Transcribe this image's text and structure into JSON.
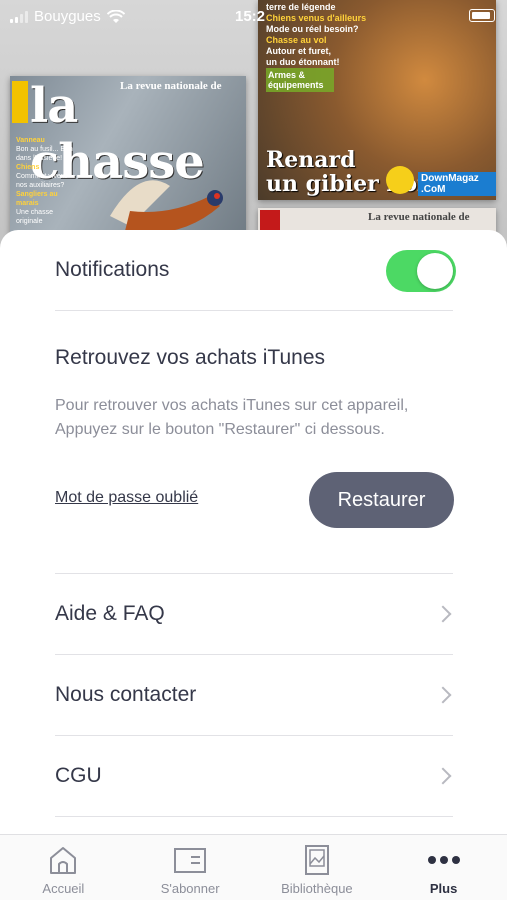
{
  "status_bar": {
    "carrier": "Bouygues",
    "time": "15:2"
  },
  "background_covers": {
    "left": {
      "masthead": "la chasse",
      "tagline": "La revue nationale de",
      "blurbs": [
        "Vanneau",
        "Bon au fusil... Bon dans l'assiette!",
        "Chiens",
        "Comment vivent nos auxiliaires?",
        "Sangliers au marais",
        "Une chasse originale"
      ]
    },
    "right": {
      "top_lines": [
        "terre de légende",
        "Chiens venus d'ailleurs",
        "Mode ou réel besoin?",
        "Chasse au vol",
        "Autour et furet,",
        "un duo étonnant!"
      ],
      "armes": "Armes & équipements",
      "headline_line1": "Renard",
      "headline_line2": "un gibier noi",
      "watermark": "DownMagaz .CoM"
    },
    "right2": {
      "tagline": "La revue nationale de"
    }
  },
  "settings": {
    "notifications_label": "Notifications",
    "notifications_on": true,
    "toggle_color": "#4cd964",
    "itunes_title": "Retrouvez vos achats iTunes",
    "itunes_description": "Pour retrouver vos achats iTunes sur cet appareil, Appuyez sur le bouton \"Restaurer\" ci dessous.",
    "forgot_password": "Mot de passe oublié",
    "restore_button": "Restaurer",
    "menu": [
      {
        "label": "Aide & FAQ",
        "icon": "chevron-right-icon"
      },
      {
        "label": "Nous contacter",
        "icon": "chevron-right-icon"
      },
      {
        "label": "CGU",
        "icon": "chevron-right-icon"
      }
    ]
  },
  "tabbar": {
    "tabs": [
      {
        "label": "Accueil",
        "icon": "home-icon",
        "active": false
      },
      {
        "label": "S'abonner",
        "icon": "subscribe-card-icon",
        "active": false
      },
      {
        "label": "Bibliothèque",
        "icon": "library-icon",
        "active": false
      },
      {
        "label": "Plus",
        "icon": "more-dots-icon",
        "active": true
      }
    ]
  }
}
